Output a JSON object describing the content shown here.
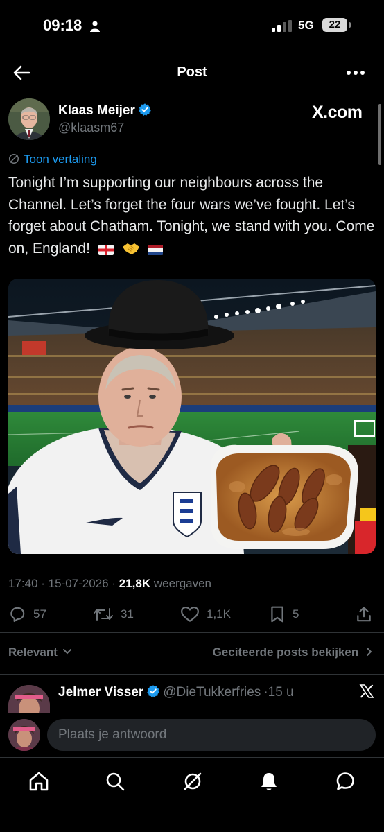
{
  "status_bar": {
    "time": "09:18",
    "network": "5G",
    "battery": "22"
  },
  "header": {
    "title": "Post"
  },
  "post": {
    "author_name": "Klaas Meijer",
    "author_handle": "@klaasm67",
    "watermark": "X.com",
    "translate_label": "Toon vertaling",
    "text": "Tonight I’m supporting our neighbours across the Channel. Let’s forget the four wars we’ve fought. Let’s forget about Chatham. Tonight, we stand with you. Come on, England!",
    "emojis": [
      "england-flag",
      "handshake",
      "netherlands-flag"
    ],
    "time": "17:40",
    "date": "15-07-2026",
    "views_count": "21,8K",
    "views_label": "weergaven",
    "replies": "57",
    "reposts": "31",
    "likes": "1,1K",
    "bookmarks": "5"
  },
  "sort": {
    "label": "Relevant",
    "quotes_link": "Geciteerde posts bekijken"
  },
  "reply_preview": {
    "name": "Jelmer Visser",
    "handle": "@DieTukkerfries",
    "age": "15 u"
  },
  "compose": {
    "placeholder": "Plaats je antwoord"
  },
  "nav": [
    "home-icon",
    "search-icon",
    "grok-icon",
    "notifications-icon",
    "messages-icon"
  ],
  "colors": {
    "background": "#000000",
    "accent": "#1d9bf0",
    "muted": "#71767b",
    "text": "#e7e9ea"
  }
}
